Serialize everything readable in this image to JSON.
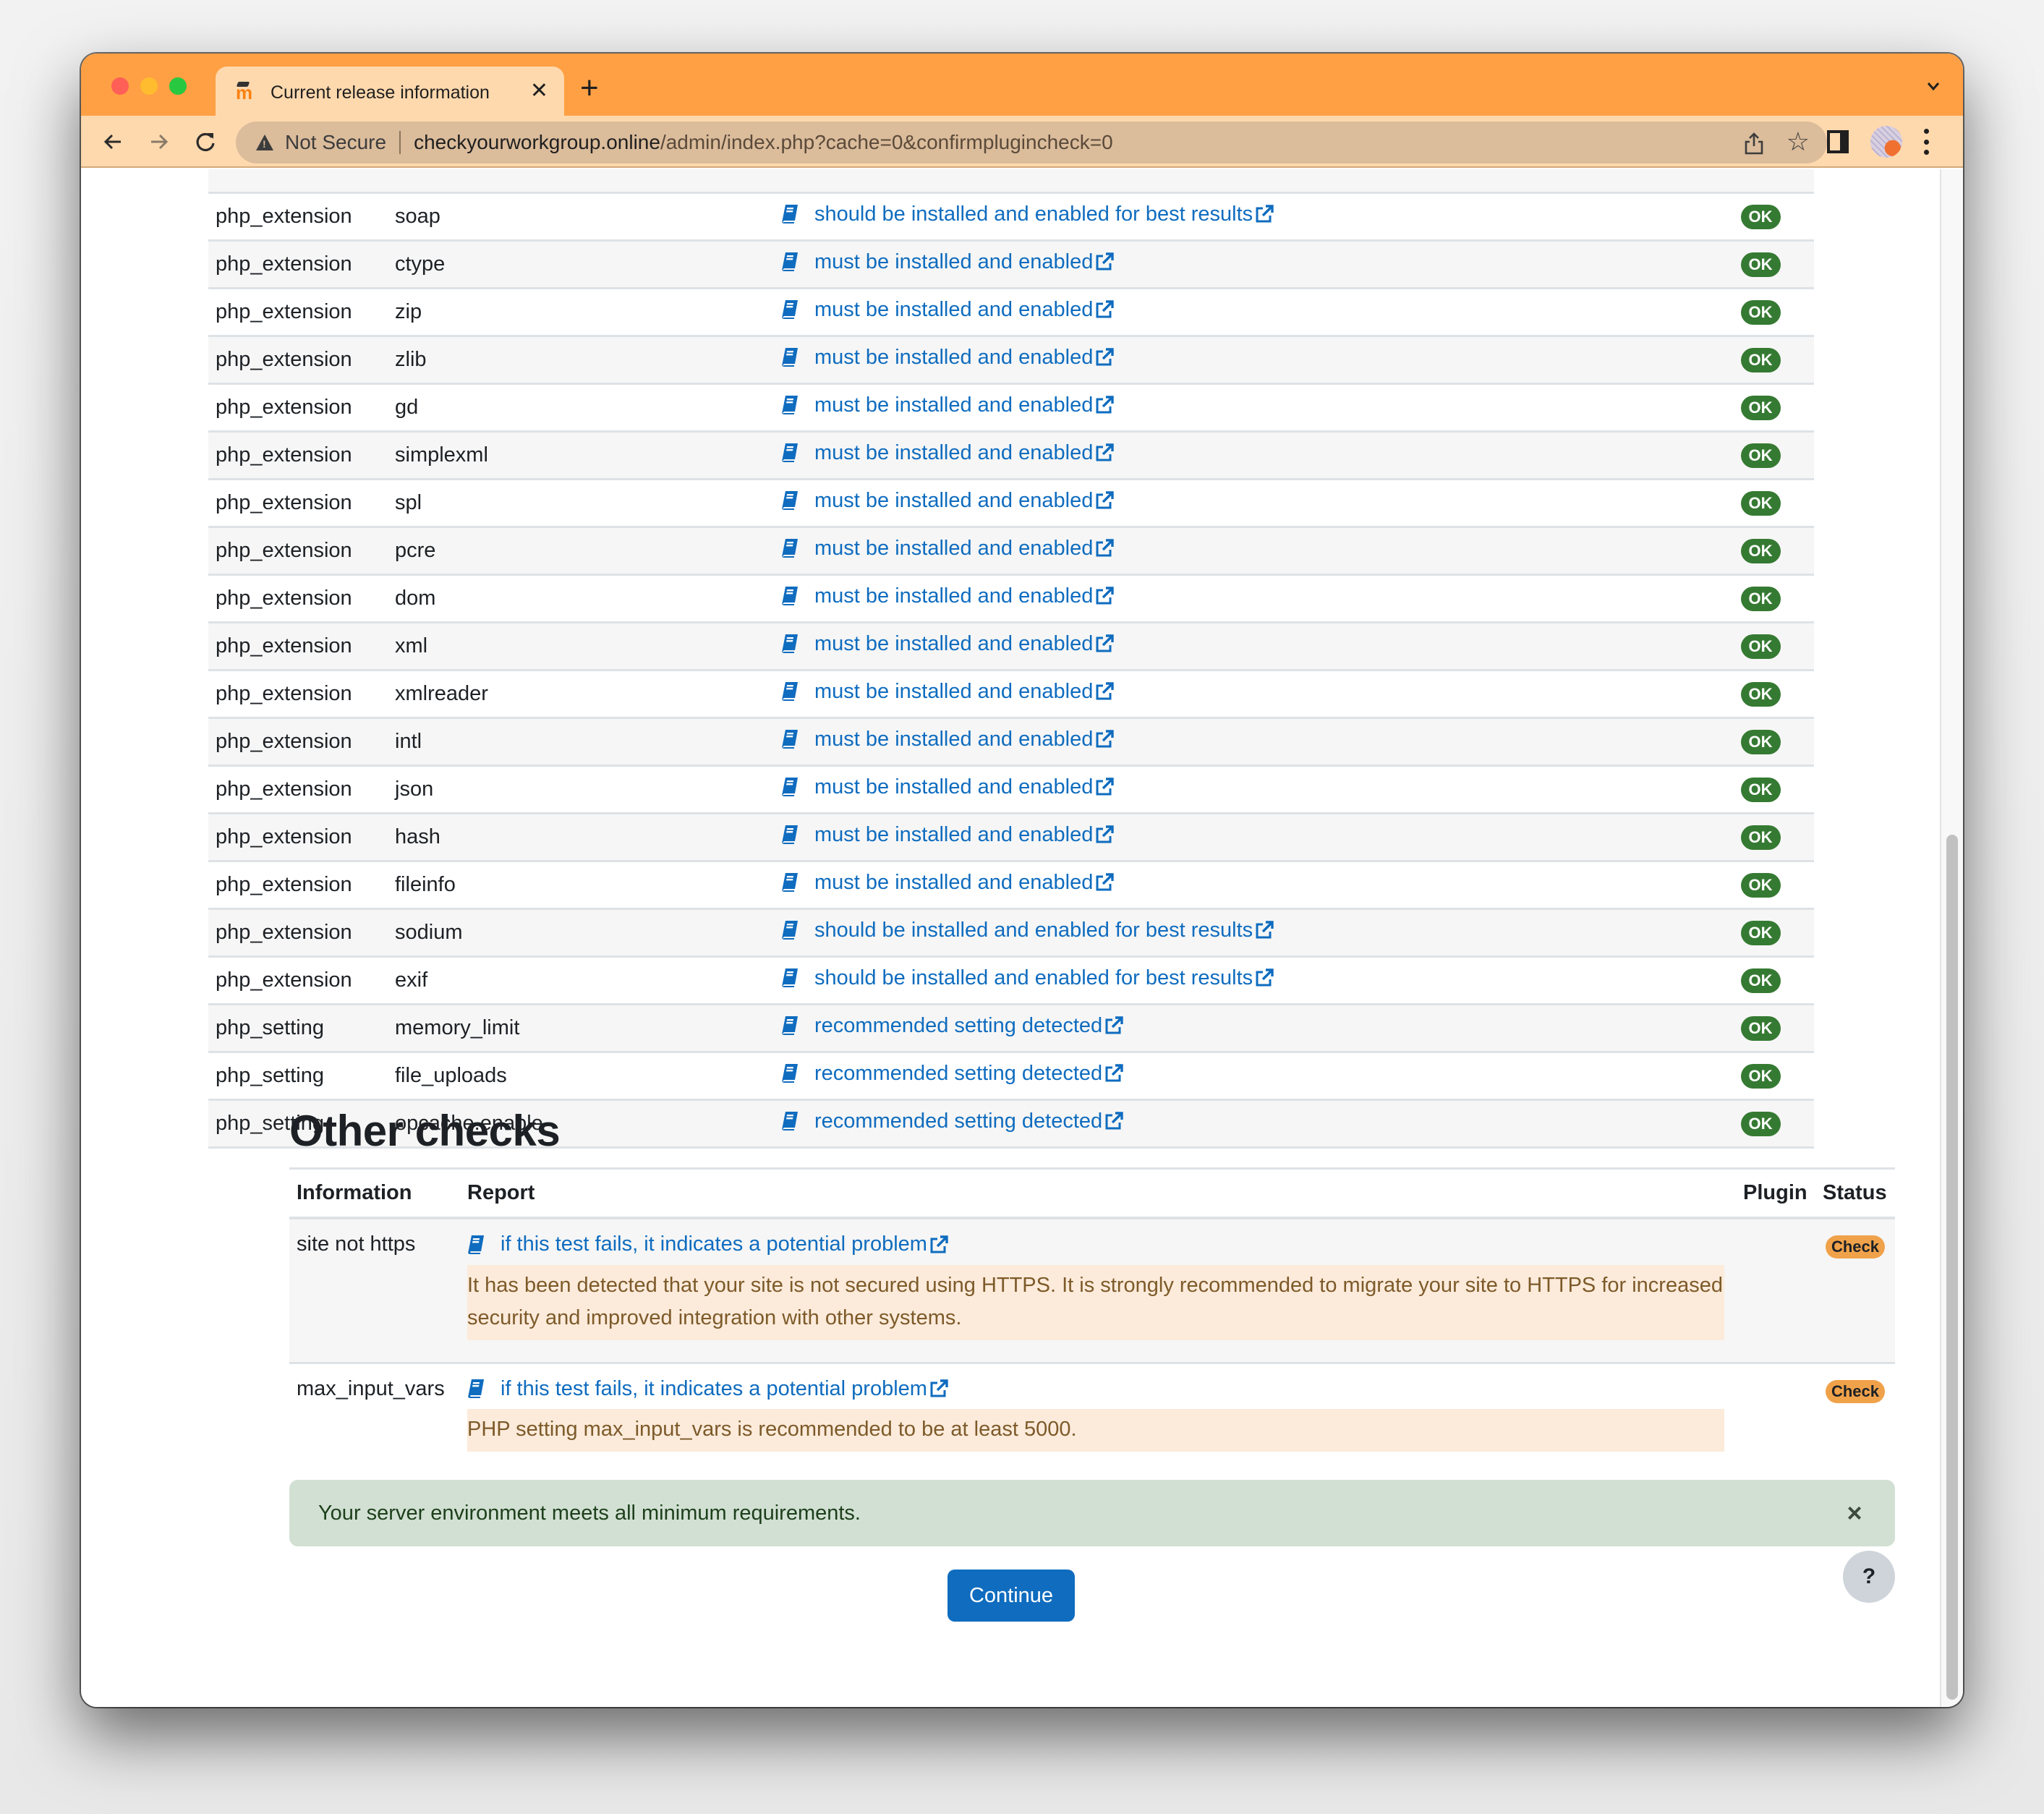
{
  "browser": {
    "tab_title": "Current release information",
    "tab_close_icon": "close-icon",
    "new_tab_icon": "plus-icon",
    "security_label": "Not Secure",
    "url_host": "checkyourworkgroup.online",
    "url_path": "/admin/index.php?cache=0&confirmplugincheck=0"
  },
  "environment": {
    "rows": [
      {
        "type": "php_extension",
        "name": "soap",
        "report": "should be installed and enabled for best results",
        "status": "OK"
      },
      {
        "type": "php_extension",
        "name": "ctype",
        "report": "must be installed and enabled",
        "status": "OK"
      },
      {
        "type": "php_extension",
        "name": "zip",
        "report": "must be installed and enabled",
        "status": "OK"
      },
      {
        "type": "php_extension",
        "name": "zlib",
        "report": "must be installed and enabled",
        "status": "OK"
      },
      {
        "type": "php_extension",
        "name": "gd",
        "report": "must be installed and enabled",
        "status": "OK"
      },
      {
        "type": "php_extension",
        "name": "simplexml",
        "report": "must be installed and enabled",
        "status": "OK"
      },
      {
        "type": "php_extension",
        "name": "spl",
        "report": "must be installed and enabled",
        "status": "OK"
      },
      {
        "type": "php_extension",
        "name": "pcre",
        "report": "must be installed and enabled",
        "status": "OK"
      },
      {
        "type": "php_extension",
        "name": "dom",
        "report": "must be installed and enabled",
        "status": "OK"
      },
      {
        "type": "php_extension",
        "name": "xml",
        "report": "must be installed and enabled",
        "status": "OK"
      },
      {
        "type": "php_extension",
        "name": "xmlreader",
        "report": "must be installed and enabled",
        "status": "OK"
      },
      {
        "type": "php_extension",
        "name": "intl",
        "report": "must be installed and enabled",
        "status": "OK"
      },
      {
        "type": "php_extension",
        "name": "json",
        "report": "must be installed and enabled",
        "status": "OK"
      },
      {
        "type": "php_extension",
        "name": "hash",
        "report": "must be installed and enabled",
        "status": "OK"
      },
      {
        "type": "php_extension",
        "name": "fileinfo",
        "report": "must be installed and enabled",
        "status": "OK"
      },
      {
        "type": "php_extension",
        "name": "sodium",
        "report": "should be installed and enabled for best results",
        "status": "OK"
      },
      {
        "type": "php_extension",
        "name": "exif",
        "report": "should be installed and enabled for best results",
        "status": "OK"
      },
      {
        "type": "php_setting",
        "name": "memory_limit",
        "report": "recommended setting detected",
        "status": "OK"
      },
      {
        "type": "php_setting",
        "name": "file_uploads",
        "report": "recommended setting detected",
        "status": "OK"
      },
      {
        "type": "php_setting",
        "name": "opcache.enable",
        "report": "recommended setting detected",
        "status": "OK"
      }
    ]
  },
  "other_checks": {
    "heading": "Other checks",
    "columns": [
      "Information",
      "Report",
      "Plugin",
      "Status"
    ],
    "rows": [
      {
        "information": "site not https",
        "report_link": "if this test fails, it indicates a potential problem",
        "message": "It has been detected that your site is not secured using HTTPS. It is strongly recommended to migrate your site to HTTPS for increased security and improved integration with other systems.",
        "plugin": "",
        "status": "Check"
      },
      {
        "information": "max_input_vars",
        "report_link": "if this test fails, it indicates a potential problem",
        "message": "PHP setting max_input_vars is recommended to be at least 5000.",
        "plugin": "",
        "status": "Check"
      }
    ]
  },
  "alert": {
    "message": "Your server environment meets all minimum requirements.",
    "close_label": "×"
  },
  "continue_label": "Continue",
  "help_label": "?",
  "colors": {
    "accent": "#0f6cbf",
    "ok_badge": "#357a32",
    "check_badge": "#f0a24a",
    "alert_bg": "#d2e0d3",
    "warning_bg": "#fcebdb",
    "browser_frame": "#ffa044"
  }
}
